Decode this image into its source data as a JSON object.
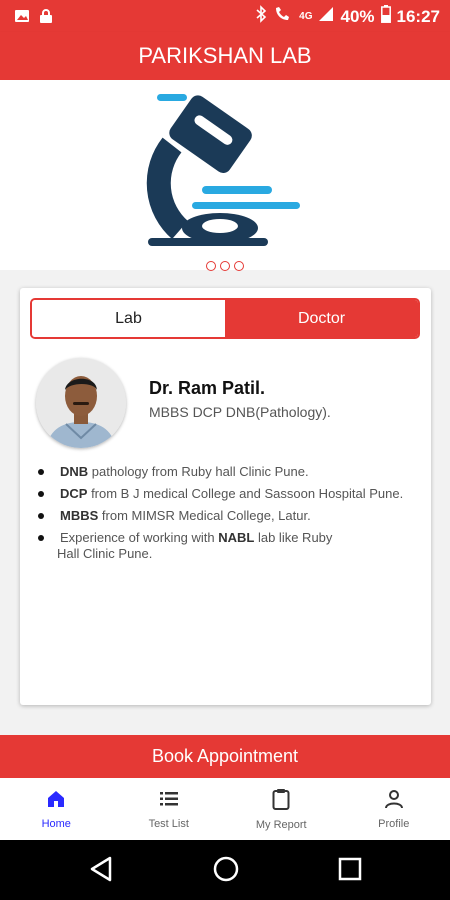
{
  "status_bar": {
    "network": "4G",
    "battery": "40%",
    "time": "16:27",
    "icons": [
      "image-icon",
      "lock-icon",
      "bluetooth-icon",
      "wifi-call-icon",
      "signal-icon",
      "battery-icon"
    ]
  },
  "app_bar": {
    "title": "PARIKSHAN LAB"
  },
  "banner": {
    "logo": "microscope-logo",
    "dots_count": 3
  },
  "tabs": {
    "lab": "Lab",
    "doctor": "Doctor",
    "active": "doctor"
  },
  "doctor": {
    "name": "Dr. Ram Patil.",
    "qualifications": "MBBS DCP DNB(Pathology).",
    "highlights": [
      {
        "bold": "DNB",
        "text": " pathology from Ruby hall Clinic Pune."
      },
      {
        "bold": "DCP",
        "text": " from B J medical College and Sassoon Hospital Pune."
      },
      {
        "bold": "MBBS",
        "text": " from MIMSR Medical College, Latur."
      },
      {
        "pre": "Experience of working with ",
        "bold": "NABL",
        "text": " lab like Ruby",
        "cont": "Hall Clinic Pune."
      }
    ]
  },
  "book_button": "Book Appointment",
  "bottom_nav": [
    {
      "label": "Home",
      "icon": "home-icon",
      "active": true
    },
    {
      "label": "Test List",
      "icon": "list-icon",
      "active": false
    },
    {
      "label": "My Report",
      "icon": "clipboard-icon",
      "active": false
    },
    {
      "label": "Profile",
      "icon": "person-icon",
      "active": false
    }
  ],
  "colors": {
    "primary": "#e53935",
    "active_nav": "#2a2aff",
    "logo_dark": "#1b3a57",
    "logo_light": "#29a9e1"
  }
}
